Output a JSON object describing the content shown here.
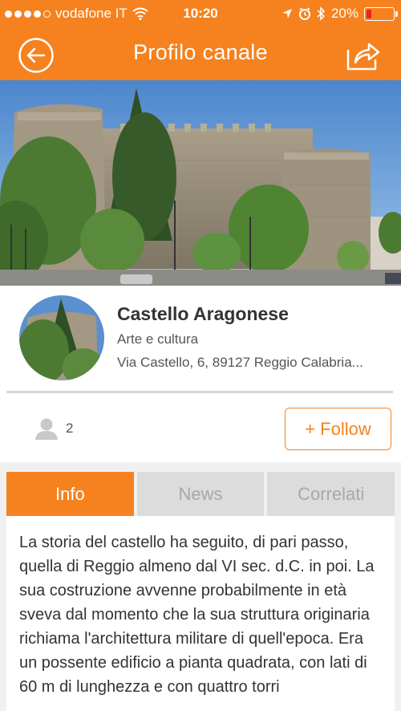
{
  "status_bar": {
    "carrier": "vodafone IT",
    "time": "10:20",
    "battery": "20%",
    "battery_level": 0.2,
    "icons": [
      "signal-dots",
      "wifi-icon",
      "location-arrow-icon",
      "alarm-icon",
      "bluetooth-icon",
      "battery-icon"
    ]
  },
  "nav": {
    "title": "Profilo canale",
    "back_icon": "back-arrow-icon",
    "share_icon": "share-icon"
  },
  "profile": {
    "name": "Castello Aragonese",
    "category": "Arte e cultura",
    "address": "Via Castello, 6, 89127 Reggio Calabria..."
  },
  "followers": {
    "count": "2",
    "icon": "user-icon"
  },
  "follow_button": {
    "label": "+ Follow"
  },
  "tabs": [
    {
      "label": "Info",
      "active": true
    },
    {
      "label": "News",
      "active": false
    },
    {
      "label": "Correlati",
      "active": false
    }
  ],
  "content": {
    "text": "La storia del castello ha seguito, di pari passo, quella di Reggio almeno dal VI sec. d.C. in poi. La sua costruzione avvenne probabilmente in età sveva dal momento che la sua struttura originaria richiama l'architettura militare di quell'epoca. Era un possente edificio a pianta quadrata, con lati di 60 m di lunghezza e con quattro torri"
  },
  "colors": {
    "accent": "#f5821f",
    "tab_inactive_bg": "#dcdcdc",
    "tab_inactive_text": "#a8a8a8",
    "battery_low": "#e8251f"
  }
}
